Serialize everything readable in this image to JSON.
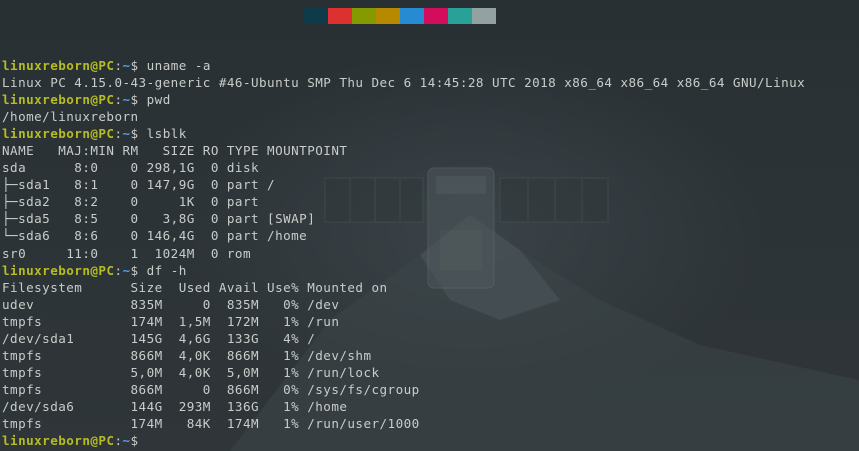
{
  "palette": [
    "#0e3a4a",
    "#dc322f",
    "#859900",
    "#b58900",
    "#268bd2",
    "#d30c5c",
    "#2aa198",
    "#93a1a1"
  ],
  "colors": {
    "background": "#2a3135",
    "text": "#c9ccc9",
    "prompt_user": "#b5bd23",
    "prompt_path": "#49a3e6"
  },
  "prompt": {
    "user_host": "linuxreborn@PC",
    "colon": ":",
    "path": "~",
    "symbol": "$ "
  },
  "lines": [
    {
      "type": "cmd",
      "text": "uname -a"
    },
    {
      "type": "out",
      "text": "Linux PC 4.15.0-43-generic #46-Ubuntu SMP Thu Dec 6 14:45:28 UTC 2018 x86_64 x86_64 x86_64 GNU/Linux"
    },
    {
      "type": "cmd",
      "text": "pwd"
    },
    {
      "type": "out",
      "text": "/home/linuxreborn"
    },
    {
      "type": "cmd",
      "text": "lsblk"
    },
    {
      "type": "out",
      "text": "NAME   MAJ:MIN RM   SIZE RO TYPE MOUNTPOINT"
    },
    {
      "type": "out",
      "text": "sda      8:0    0 298,1G  0 disk "
    },
    {
      "type": "out",
      "text": "├─sda1   8:1    0 147,9G  0 part /"
    },
    {
      "type": "out",
      "text": "├─sda2   8:2    0     1K  0 part "
    },
    {
      "type": "out",
      "text": "├─sda5   8:5    0   3,8G  0 part [SWAP]"
    },
    {
      "type": "out",
      "text": "└─sda6   8:6    0 146,4G  0 part /home"
    },
    {
      "type": "out",
      "text": "sr0     11:0    1  1024M  0 rom  "
    },
    {
      "type": "cmd",
      "text": "df -h"
    },
    {
      "type": "out",
      "text": "Filesystem      Size  Used Avail Use% Mounted on"
    },
    {
      "type": "out",
      "text": "udev            835M     0  835M   0% /dev"
    },
    {
      "type": "out",
      "text": "tmpfs           174M  1,5M  172M   1% /run"
    },
    {
      "type": "out",
      "text": "/dev/sda1       145G  4,6G  133G   4% /"
    },
    {
      "type": "out",
      "text": "tmpfs           866M  4,0K  866M   1% /dev/shm"
    },
    {
      "type": "out",
      "text": "tmpfs           5,0M  4,0K  5,0M   1% /run/lock"
    },
    {
      "type": "out",
      "text": "tmpfs           866M     0  866M   0% /sys/fs/cgroup"
    },
    {
      "type": "out",
      "text": "/dev/sda6       144G  293M  136G   1% /home"
    },
    {
      "type": "out",
      "text": "tmpfs           174M   84K  174M   1% /run/user/1000"
    },
    {
      "type": "cmd",
      "text": ""
    }
  ]
}
